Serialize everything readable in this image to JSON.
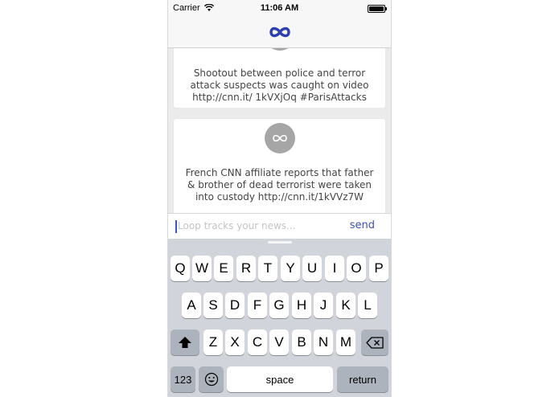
{
  "status_bar": {
    "carrier": "Carrier",
    "time": "11:06 AM"
  },
  "nav": {
    "logo": "infinity-icon"
  },
  "feed": {
    "cards": [
      {
        "text": "Shootout between police and terror attack suspects was caught on video http://cnn.it/ 1kVXjOq  #ParisAttacks"
      },
      {
        "text": "French CNN affiliate reports that father & brother of dead terrorist were taken into custody http://cnn.it/1kVVz7W"
      }
    ]
  },
  "composer": {
    "placeholder": "Loop tracks your news...",
    "send_label": "send"
  },
  "keyboard": {
    "row1": [
      "Q",
      "W",
      "E",
      "R",
      "T",
      "Y",
      "U",
      "I",
      "O",
      "P"
    ],
    "row2": [
      "A",
      "S",
      "D",
      "F",
      "G",
      "H",
      "J",
      "K",
      "L"
    ],
    "row3": [
      "Z",
      "X",
      "C",
      "V",
      "B",
      "N",
      "M"
    ],
    "numbers_label": "123",
    "space_label": "space",
    "return_label": "return"
  },
  "colors": {
    "accent": "#3f4fb5",
    "logo": "#2f3fb0",
    "avatar": "#a6a6a6"
  }
}
